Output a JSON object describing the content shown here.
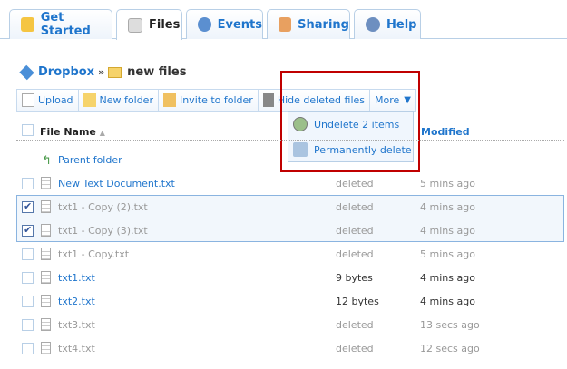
{
  "tabs": [
    {
      "label": "Get Started",
      "icon": "cake-icon"
    },
    {
      "label": "Files",
      "icon": "files-icon",
      "active": true
    },
    {
      "label": "Events",
      "icon": "clock-icon"
    },
    {
      "label": "Sharing",
      "icon": "people-icon"
    },
    {
      "label": "Help",
      "icon": "help-icon"
    }
  ],
  "breadcrumb": {
    "root": "Dropbox",
    "sep": "»",
    "folder": "new files"
  },
  "toolbar": {
    "upload": "Upload",
    "new_folder": "New folder",
    "invite": "Invite to folder",
    "hide_deleted": "Hide deleted files",
    "more": "More"
  },
  "more_menu": {
    "undelete": "Undelete 2 items",
    "perm_delete": "Permanently delete"
  },
  "header": {
    "name": "File Name",
    "sort": "▲",
    "modified": "Modified"
  },
  "parent": "Parent folder",
  "files": [
    {
      "name": "New Text Document.txt",
      "size": "deleted",
      "modified": "5 mins ago",
      "checked": false,
      "style": "blue-deleted"
    },
    {
      "name": "txt1 - Copy (2).txt",
      "size": "deleted",
      "modified": "4 mins ago",
      "checked": true,
      "style": "deleted"
    },
    {
      "name": "txt1 - Copy (3).txt",
      "size": "deleted",
      "modified": "4 mins ago",
      "checked": true,
      "style": "deleted"
    },
    {
      "name": "txt1 - Copy.txt",
      "size": "deleted",
      "modified": "5 mins ago",
      "checked": false,
      "style": "deleted"
    },
    {
      "name": "txt1.txt",
      "size": "9 bytes",
      "modified": "4 mins ago",
      "checked": false,
      "style": "normal"
    },
    {
      "name": "txt2.txt",
      "size": "12 bytes",
      "modified": "4 mins ago",
      "checked": false,
      "style": "normal"
    },
    {
      "name": "txt3.txt",
      "size": "deleted",
      "modified": "13 secs ago",
      "checked": false,
      "style": "deleted"
    },
    {
      "name": "txt4.txt",
      "size": "deleted",
      "modified": "12 secs ago",
      "checked": false,
      "style": "deleted"
    }
  ]
}
